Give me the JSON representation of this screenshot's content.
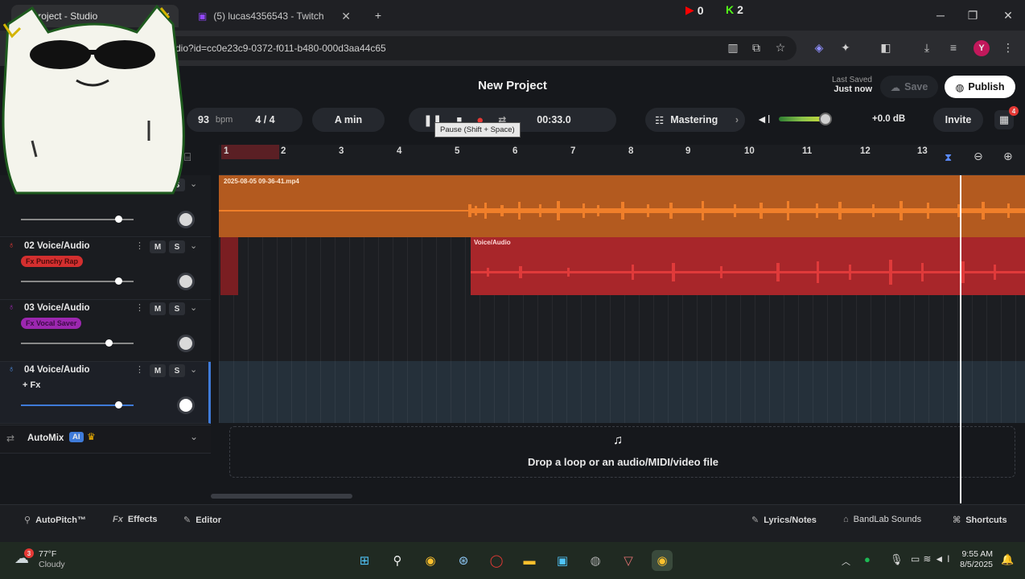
{
  "browser": {
    "tabs": [
      {
        "label": "Project - Studio"
      },
      {
        "label": "(5) lucas4356543 - Twitch"
      }
    ],
    "new_tab": "+",
    "youtube_count": "0",
    "kick_count": "2",
    "url": "studio?id=cc0e23c9-0372-f011-b480-000d3aa44c65",
    "profile_initial": "Y"
  },
  "app": {
    "project_title": "New Project",
    "last_saved_label": "Last Saved",
    "last_saved_value": "Just now",
    "save_label": "Save",
    "publish_label": "Publish",
    "tempo": "93",
    "tempo_unit": "bpm",
    "time_signature": "4 / 4",
    "key": "A min",
    "time": "00:33.0",
    "tooltip": "Pause (Shift + Space)",
    "mastering_label": "Mastering",
    "volume_db": "+0.0 dB",
    "invite_label": "Invite",
    "notification_count": "4",
    "ruler_numbers": [
      "1",
      "2",
      "3",
      "4",
      "5",
      "6",
      "7",
      "8",
      "9",
      "10",
      "11",
      "12",
      "13"
    ],
    "tracks": [
      {
        "name": "",
        "fx": "",
        "clip": "2025-08-05 09-36-41.mp4",
        "volume": 0.82
      },
      {
        "name": "02  Voice/Audio",
        "fx": "Fx Punchy Rap",
        "clip": "Voice/Audio",
        "volume": 0.82
      },
      {
        "name": "03  Voice/Audio",
        "fx": "Fx Vocal Saver",
        "clip": "",
        "volume": 0.75
      },
      {
        "name": "04  Voice/Audio",
        "fx": "+ Fx",
        "clip": "",
        "volume": 0.82
      }
    ],
    "automix_label": "AutoMix",
    "automix_badge": "AI",
    "drop_text": "Drop a loop or an audio/MIDI/video file",
    "bottom_left": [
      "AutoPitch™",
      "Effects",
      "Editor"
    ],
    "bottom_right": [
      "Lyrics/Notes",
      "BandLab Sounds",
      "Shortcuts"
    ]
  },
  "taskbar": {
    "weather_temp": "77°F",
    "weather_desc": "Cloudy",
    "weather_badge": "3",
    "time": "9:55 AM",
    "date": "8/5/2025"
  },
  "colors": {
    "track1": "#b35a1f",
    "track1_wave": "#f07f2a",
    "track2": "#a8262a",
    "track2_wave": "#e03a3a",
    "publish_bg": "#ffffff",
    "playhead": "#ffffff"
  }
}
